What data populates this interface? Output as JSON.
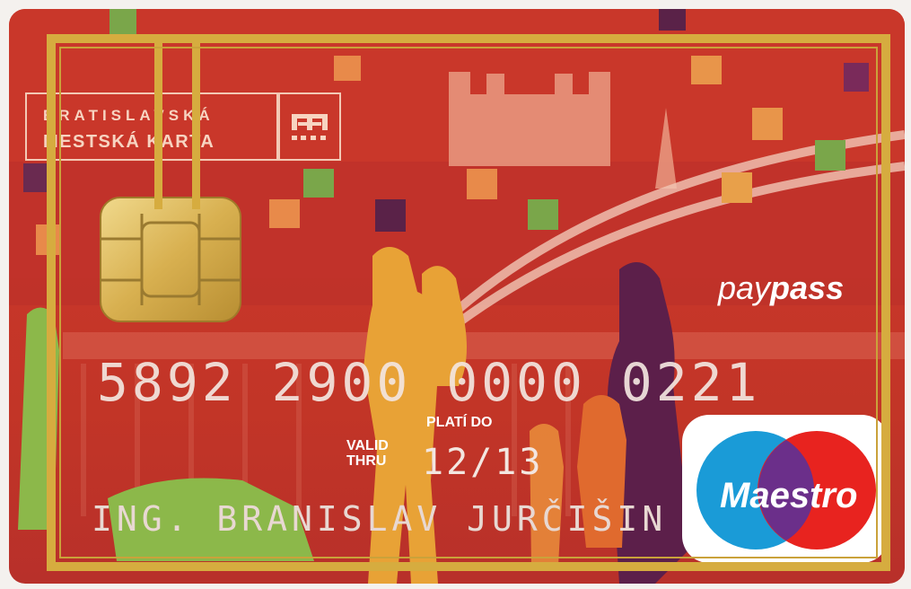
{
  "card": {
    "brand_line1": "BRATISLAVSKÁ",
    "brand_line2": "MESTSKÁ KARTA",
    "paypass_pay": "pay",
    "paypass_pass": "pass",
    "number": "5892 2900 0000 0221",
    "valid_label_sk": "PLATÍ DO",
    "valid_label_en_1": "VALID",
    "valid_label_en_2": "THRU",
    "expiry": "12/13",
    "holder": "ING. BRANISLAV JURČIŠIN",
    "network": "Maestro",
    "colors": {
      "card_red": "#c8362a",
      "frame_gold": "#d6ac3f",
      "maestro_blue": "#1a9bd7",
      "maestro_red": "#e8231f"
    }
  }
}
